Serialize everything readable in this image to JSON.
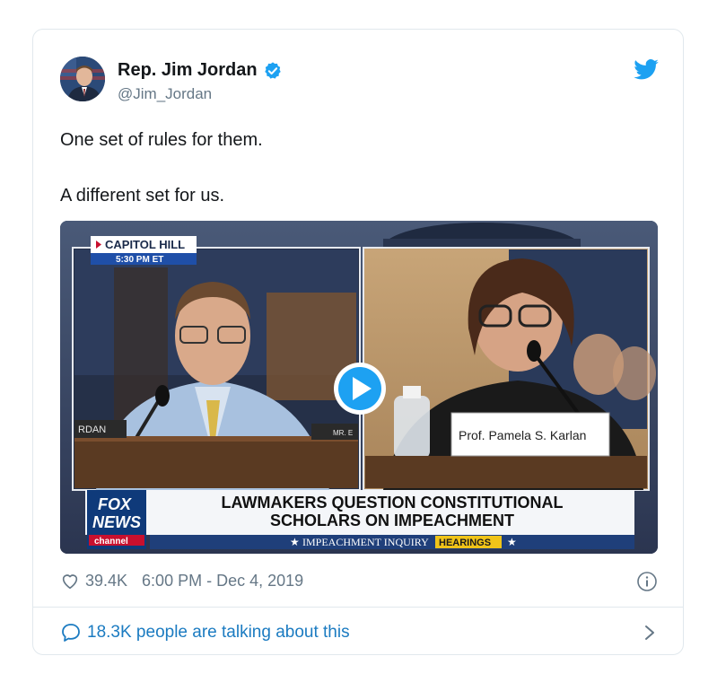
{
  "tweet": {
    "author_name": "Rep. Jim Jordan",
    "handle": "@Jim_Jordan",
    "text": "One set of rules for them.\n\nA different set for us.",
    "likes": "39.4K",
    "timestamp": "6:00 PM - Dec 4, 2019",
    "talking": "18.3K people are talking about this"
  },
  "video": {
    "location_tag": "CAPITOL HILL",
    "time_tag": "5:30 PM ET",
    "left_nameplate": "RDAN",
    "mid_nameplate": "MR. E",
    "right_nameplate": "Prof. Pamela S. Karlan",
    "headline_line1": "LAWMAKERS QUESTION CONSTITUTIONAL",
    "headline_line2": "SCHOLARS ON IMPEACHMENT",
    "ticker_text": "IMPEACHMENT INQUIRY",
    "ticker_highlight": "HEARINGS",
    "logo_top": "FOX",
    "logo_mid": "NEWS",
    "logo_bottom": "channel"
  },
  "colors": {
    "accent": "#1da1f2",
    "link": "#1b7bc1",
    "text": "#14171a",
    "muted": "#657786",
    "border": "#e1e8ed"
  },
  "icons": [
    "verified-badge-icon",
    "twitter-bird-icon",
    "play-icon",
    "heart-icon",
    "info-icon",
    "speech-bubble-icon",
    "chevron-right-icon"
  ]
}
